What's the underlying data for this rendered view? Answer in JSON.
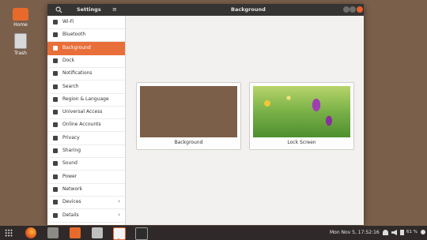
{
  "desktop": {
    "home_label": "Home",
    "trash_label": "Trash"
  },
  "window": {
    "app_title": "Settings",
    "page_title": "Background",
    "menu_glyph": "≡"
  },
  "sidebar": {
    "items": [
      {
        "label": "Wi-Fi",
        "icon": "wifi-icon"
      },
      {
        "label": "Bluetooth",
        "icon": "bluetooth-icon"
      },
      {
        "label": "Background",
        "icon": "background-icon",
        "active": true
      },
      {
        "label": "Dock",
        "icon": "dock-icon"
      },
      {
        "label": "Notifications",
        "icon": "bell-icon"
      },
      {
        "label": "Search",
        "icon": "search-icon"
      },
      {
        "label": "Region & Language",
        "icon": "region-icon"
      },
      {
        "label": "Universal Access",
        "icon": "accessibility-icon"
      },
      {
        "label": "Online Accounts",
        "icon": "accounts-icon"
      },
      {
        "label": "Privacy",
        "icon": "privacy-icon"
      },
      {
        "label": "Sharing",
        "icon": "sharing-icon"
      },
      {
        "label": "Sound",
        "icon": "sound-icon"
      },
      {
        "label": "Power",
        "icon": "power-icon"
      },
      {
        "label": "Network",
        "icon": "network-icon"
      },
      {
        "label": "Devices",
        "icon": "devices-icon",
        "chevron": "›"
      },
      {
        "label": "Details",
        "icon": "details-icon",
        "chevron": "›"
      }
    ]
  },
  "content": {
    "background_card_label": "Background",
    "lockscreen_card_label": "Lock Screen"
  },
  "taskbar": {
    "clock": "Mon Nov  5, 17:52:16",
    "battery": "61 %"
  },
  "colors": {
    "accent": "#e86f3a",
    "desktop": "#7a5f4b",
    "titlebar": "#353433"
  }
}
